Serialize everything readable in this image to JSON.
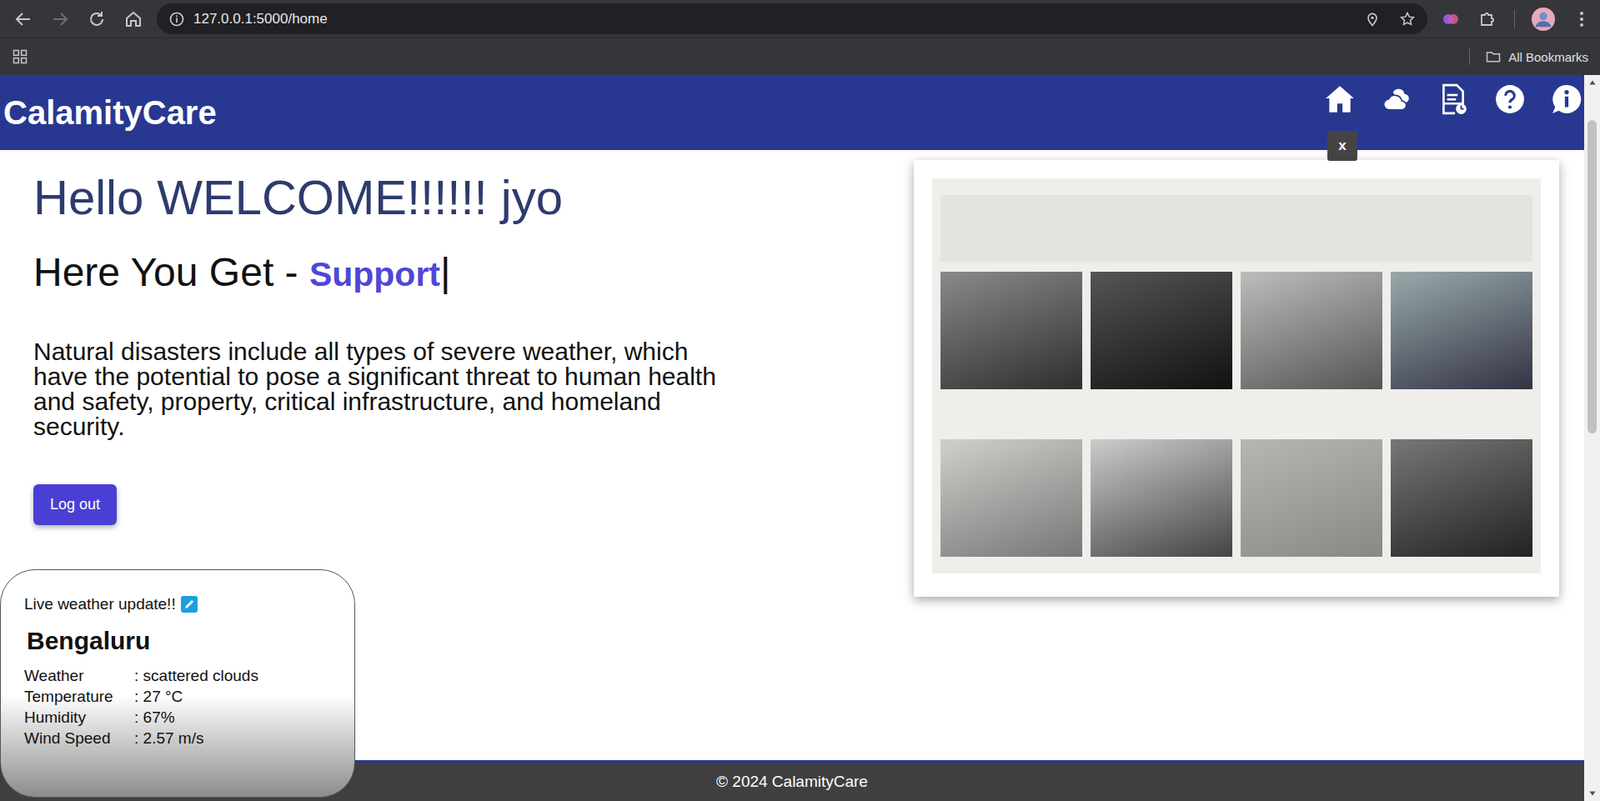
{
  "browser": {
    "url": "127.0.0.1:5000/home",
    "bookmarks": "All Bookmarks"
  },
  "header": {
    "logo": "CalamityCare"
  },
  "close_button": "x",
  "greeting": "Hello WELCOME!!!!!! jyo",
  "tagline": {
    "prefix": "Here You Get - ",
    "highlight": "Support",
    "cursor": "|"
  },
  "description": "Natural disasters include all types of severe weather, which have the potential to pose a significant threat to human health and safety, property, critical infrastructure, and homeland security.",
  "logout_button": "Log out",
  "weather": {
    "title": "Live weather update!!",
    "city": "Bengaluru",
    "separator": ":",
    "rows": [
      {
        "label": "Weather",
        "value": "scattered clouds"
      },
      {
        "label": "Temperature",
        "value": "27 °C"
      },
      {
        "label": "Humidity",
        "value": "67%"
      },
      {
        "label": "Wind Speed",
        "value": "2.57 m/s"
      }
    ]
  },
  "footer": "© 2024 CalamityCare"
}
